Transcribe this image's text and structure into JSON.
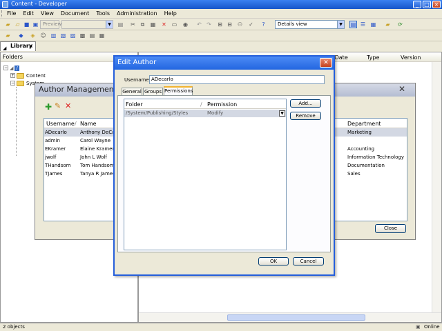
{
  "window": {
    "title": "Content - Developer"
  },
  "menu": [
    "File",
    "Edit",
    "View",
    "Document",
    "Tools",
    "Administration",
    "Help"
  ],
  "toolbar": {
    "preview_label": "Preview",
    "view_combo": "Details view"
  },
  "library_tab": {
    "label": "Library"
  },
  "left_pane": {
    "header": "Folders",
    "tree": [
      {
        "label": "/",
        "level": 0
      },
      {
        "label": "Content",
        "level": 1
      },
      {
        "label": "System",
        "level": 1
      }
    ]
  },
  "right_pane": {
    "headers": {
      "date": "d Date",
      "type": "Type",
      "version": "Version"
    }
  },
  "status": {
    "objects": "2 objects",
    "mode": "Online"
  },
  "author_management": {
    "title": "Author Management",
    "columns": {
      "username": "Username",
      "name": "Name",
      "department": "Department"
    },
    "rows": [
      {
        "username": "ADecarlo",
        "name": "Anthony  DeCarlo",
        "department": "Marketing",
        "selected": true
      },
      {
        "username": "admin",
        "name": "Carol  Wayne",
        "department": ""
      },
      {
        "username": "EKramer",
        "name": "Elaine  Kramer",
        "department": "Accounting"
      },
      {
        "username": "jwolf",
        "name": "John L Wolf",
        "department": "Information Technology"
      },
      {
        "username": "THandsom",
        "name": "Tom  Handsom",
        "department": "Documentation"
      },
      {
        "username": "TJames",
        "name": "Tanya R James",
        "department": "Sales"
      }
    ],
    "close_label": "Close"
  },
  "edit_author": {
    "title": "Edit Author",
    "username_label": "Username:",
    "username_value": "ADecarlo",
    "tabs": [
      "General",
      "Groups",
      "Permissions"
    ],
    "active_tab": "Permissions",
    "columns": {
      "folder": "Folder",
      "permission": "Permission"
    },
    "rows": [
      {
        "folder": "/System/Publishing/Styles",
        "permission": "Modify"
      }
    ],
    "add_label": "Add...",
    "remove_label": "Remove",
    "ok_label": "OK",
    "cancel_label": "Cancel"
  }
}
